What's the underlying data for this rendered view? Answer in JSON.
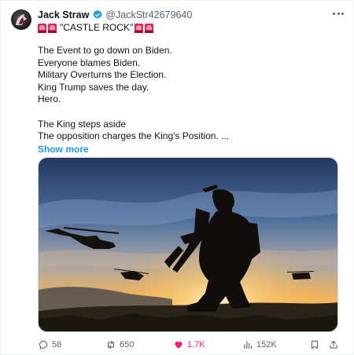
{
  "author": {
    "name": "Jack Straw",
    "handle": "@JackStr42679640",
    "verified": true,
    "verified_color": "#1d9bf0"
  },
  "post": {
    "title": "\"CASTLE ROCK\"",
    "title_icons": [
      "siren-icon",
      "siren-icon",
      "siren-icon",
      "siren-icon"
    ],
    "lines_1": [
      "The Event to go down on Biden.",
      "Everyone blames Biden.",
      "Military Overturns the Election.",
      "King Trump saves the day.",
      "Hero."
    ],
    "lines_2": [
      "The King steps aside",
      "The opposition charges the King's Position. ..."
    ],
    "show_more": "Show more"
  },
  "media": {
    "description_icon": "soldier-silhouette-sunset-photo"
  },
  "actions": {
    "replies": "58",
    "reposts": "650",
    "likes": "1.7K",
    "views": "152K",
    "liked": true,
    "like_color": "#f91880"
  }
}
